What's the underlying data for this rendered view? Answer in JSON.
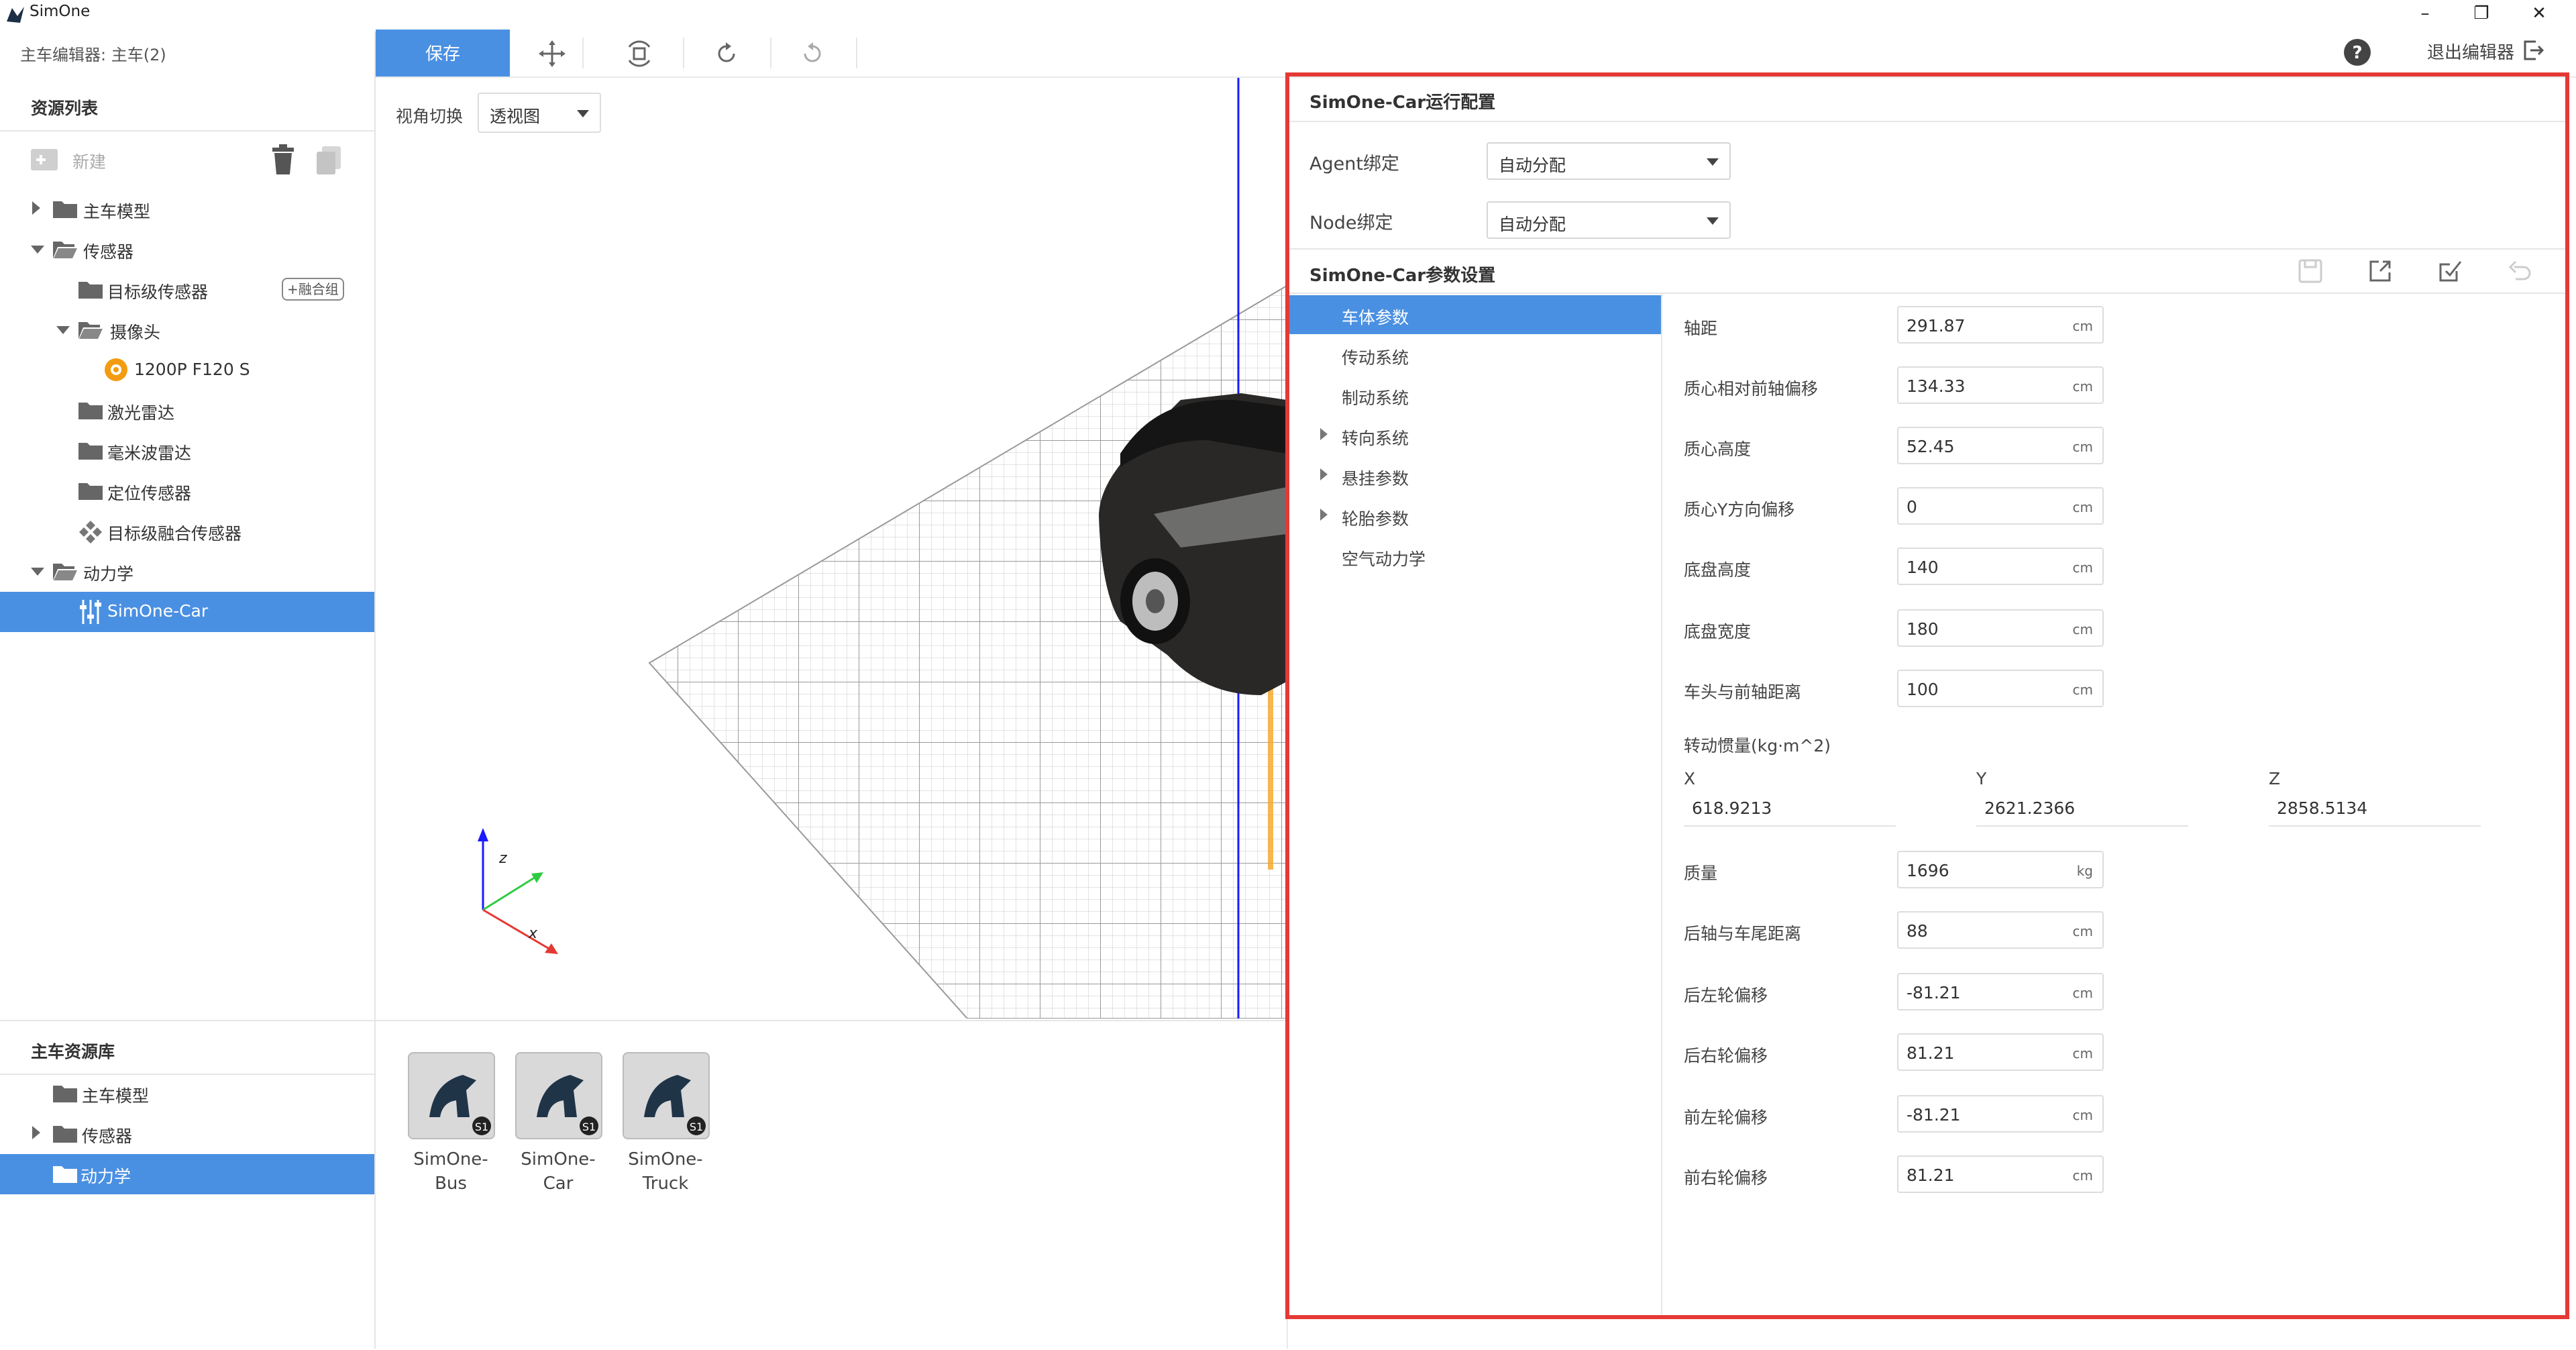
{
  "app": {
    "title": "SimOne",
    "editor_title": "主车编辑器: 主车(2)",
    "window_controls": [
      "–",
      "❐",
      "✕"
    ]
  },
  "toolbar": {
    "save_label": "保存",
    "exit_label": "退出编辑器",
    "icons": [
      "move-icon",
      "rotate-view-icon",
      "refresh-icon",
      "reset-icon"
    ]
  },
  "resource_list": {
    "header": "资源列表",
    "new_label": "新建",
    "items": [
      {
        "label": "主车模型",
        "level": 0,
        "expand": "collapsed",
        "icon": "folder"
      },
      {
        "label": "传感器",
        "level": 0,
        "expand": "expanded",
        "icon": "folder-open"
      },
      {
        "label": "目标级传感器",
        "level": 1,
        "expand": "none",
        "icon": "folder",
        "tag": "+融合组"
      },
      {
        "label": "摄像头",
        "level": 1,
        "expand": "expanded",
        "icon": "folder-open"
      },
      {
        "label": "1200P F120 S",
        "level": 2,
        "expand": "none",
        "icon": "camera-circle"
      },
      {
        "label": "激光雷达",
        "level": 1,
        "expand": "none",
        "icon": "folder"
      },
      {
        "label": "毫米波雷达",
        "level": 1,
        "expand": "none",
        "icon": "folder"
      },
      {
        "label": "定位传感器",
        "level": 1,
        "expand": "none",
        "icon": "folder"
      },
      {
        "label": "目标级融合传感器",
        "level": 1,
        "expand": "none",
        "icon": "fusion"
      },
      {
        "label": "动力学",
        "level": 0,
        "expand": "expanded",
        "icon": "folder-open"
      },
      {
        "label": "SimOne-Car",
        "level": 1,
        "expand": "none",
        "icon": "dynamics",
        "selected": true
      }
    ]
  },
  "car_library": {
    "header": "主车资源库",
    "items": [
      {
        "label": "主车模型",
        "expand": "none",
        "selected": false
      },
      {
        "label": "传感器",
        "expand": "collapsed",
        "selected": false
      },
      {
        "label": "动力学",
        "expand": "none",
        "selected": true
      }
    ],
    "cards": [
      {
        "line1": "SimOne-",
        "line2": "Bus"
      },
      {
        "line1": "SimOne-",
        "line2": "Car"
      },
      {
        "line1": "SimOne-",
        "line2": "Truck"
      }
    ]
  },
  "viewport": {
    "view_switch_label": "视角切换",
    "view_value": "透视图",
    "axis_labels": {
      "z": "z",
      "x": "x"
    }
  },
  "run_config": {
    "title": "SimOne-Car运行配置",
    "agent_label": "Agent绑定",
    "agent_value": "自动分配",
    "node_label": "Node绑定",
    "node_value": "自动分配"
  },
  "param_settings": {
    "title": "SimOne-Car参数设置",
    "action_icons": [
      "save-disabled-icon",
      "export-icon",
      "apply-icon",
      "undo-disabled-icon"
    ],
    "categories": [
      {
        "label": "车体参数",
        "expandable": false,
        "selected": true
      },
      {
        "label": "传动系统",
        "expandable": false,
        "selected": false
      },
      {
        "label": "制动系统",
        "expandable": false,
        "selected": false
      },
      {
        "label": "转向系统",
        "expandable": true,
        "selected": false
      },
      {
        "label": "悬挂参数",
        "expandable": true,
        "selected": false
      },
      {
        "label": "轮胎参数",
        "expandable": true,
        "selected": false
      },
      {
        "label": "空气动力学",
        "expandable": false,
        "selected": false
      }
    ],
    "params_top": [
      {
        "label": "轴距",
        "value": "291.87",
        "unit": "cm"
      },
      {
        "label": "质心相对前轴偏移",
        "value": "134.33",
        "unit": "cm"
      },
      {
        "label": "质心高度",
        "value": "52.45",
        "unit": "cm"
      },
      {
        "label": "质心Y方向偏移",
        "value": "0",
        "unit": "cm"
      },
      {
        "label": "底盘高度",
        "value": "140",
        "unit": "cm"
      },
      {
        "label": "底盘宽度",
        "value": "180",
        "unit": "cm"
      },
      {
        "label": "车头与前轴距离",
        "value": "100",
        "unit": "cm"
      }
    ],
    "inertia": {
      "label": "转动惯量(kg·m^2)",
      "x_label": "X",
      "x_value": "618.9213",
      "y_label": "Y",
      "y_value": "2621.2366",
      "z_label": "Z",
      "z_value": "2858.5134"
    },
    "params_bottom": [
      {
        "label": "质量",
        "value": "1696",
        "unit": "kg"
      },
      {
        "label": "后轴与车尾距离",
        "value": "88",
        "unit": "cm"
      },
      {
        "label": "后左轮偏移",
        "value": "-81.21",
        "unit": "cm"
      },
      {
        "label": "后右轮偏移",
        "value": "81.21",
        "unit": "cm"
      },
      {
        "label": "前左轮偏移",
        "value": "-81.21",
        "unit": "cm"
      },
      {
        "label": "前右轮偏移",
        "value": "81.21",
        "unit": "cm"
      }
    ]
  },
  "colors": {
    "accent": "#4a90e2",
    "highlight_border": "#e53935",
    "z_axis": "#1a1aff",
    "x_axis": "#e53935",
    "y_axis": "#2ecc40"
  }
}
